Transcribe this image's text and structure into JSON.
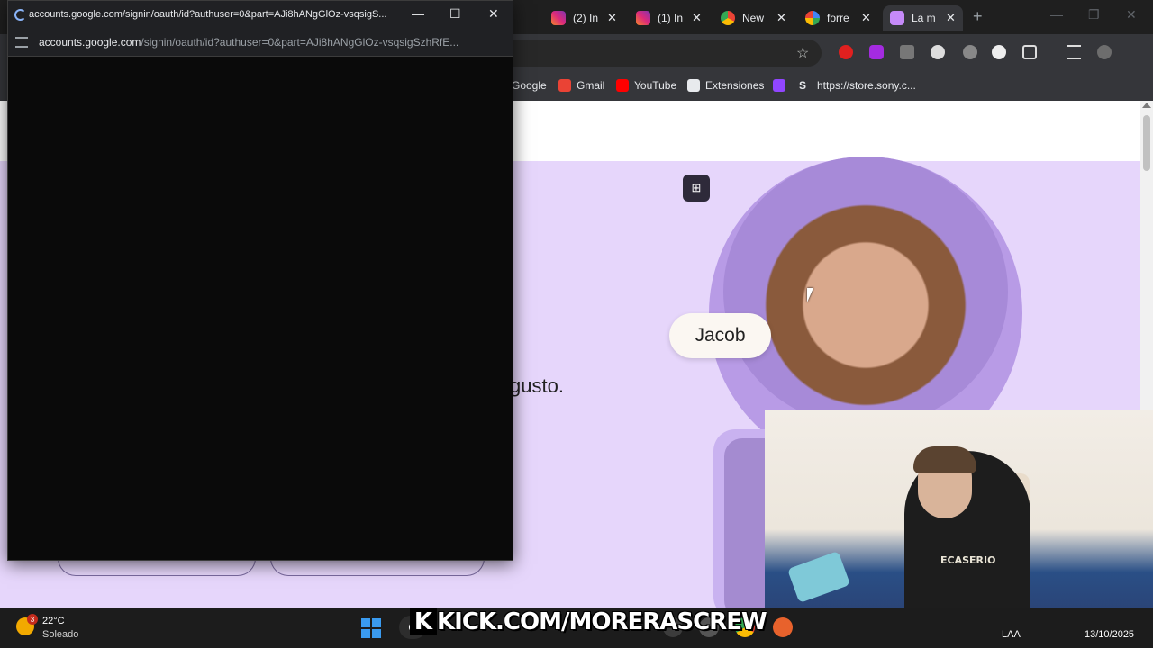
{
  "browser": {
    "tabs": [
      {
        "label": "(2) In",
        "icon": "instagram-icon",
        "color": "#d6249f"
      },
      {
        "label": "(1) In",
        "icon": "instagram-icon",
        "color": "#d6249f"
      },
      {
        "label": "New",
        "icon": "chrome-icon",
        "color": "#dadce0"
      },
      {
        "label": "forre",
        "icon": "google-icon",
        "color": "#4285f4"
      },
      {
        "label": "La m",
        "icon": "page-icon",
        "color": "#c58af9"
      }
    ],
    "close_glyph": "✕",
    "new_tab_glyph": "+",
    "bookmarks": [
      {
        "label": "Google"
      },
      {
        "label": "Gmail",
        "color": "#ea4335"
      },
      {
        "label": "YouTube",
        "color": "#ff0000"
      },
      {
        "label": "Extensiones",
        "color": "#e8eaed"
      },
      {
        "label": "",
        "color": "#9146ff"
      },
      {
        "label": "https://store.sony.c...",
        "color": "#e8eaed"
      }
    ]
  },
  "popup": {
    "title": "accounts.google.com/signin/oauth/id?authuser=0&part=AJi8hANgGlOz-vsqsigS...",
    "url_host": "accounts.google.com",
    "url_path": "/signin/oauth/id?authuser=0&part=AJi8hANgGlOz-vsqsigSzhRfE...",
    "minimize_glyph": "—",
    "maximize_glyph": "☐",
    "close_glyph": "✕"
  },
  "page": {
    "tagline": "gusto.",
    "name_chip": "Jacob",
    "chip_button_glyph": "⊞"
  },
  "webcam": {
    "shirt_text": "ECASERIO"
  },
  "overlay": {
    "kick_logo": "K",
    "kick_text": "KICK.COM/MORERASCREW"
  },
  "taskbar": {
    "weather_badge": "3",
    "temperature": "22°C",
    "weather_desc": "Soleado",
    "search_glyph": "Q",
    "language": "LAA",
    "date": "13/10/2025"
  },
  "colors": {
    "page_bg": "#e6d6fb",
    "avatar_ring": "#b89be6",
    "chrome_dark": "#35363a"
  }
}
